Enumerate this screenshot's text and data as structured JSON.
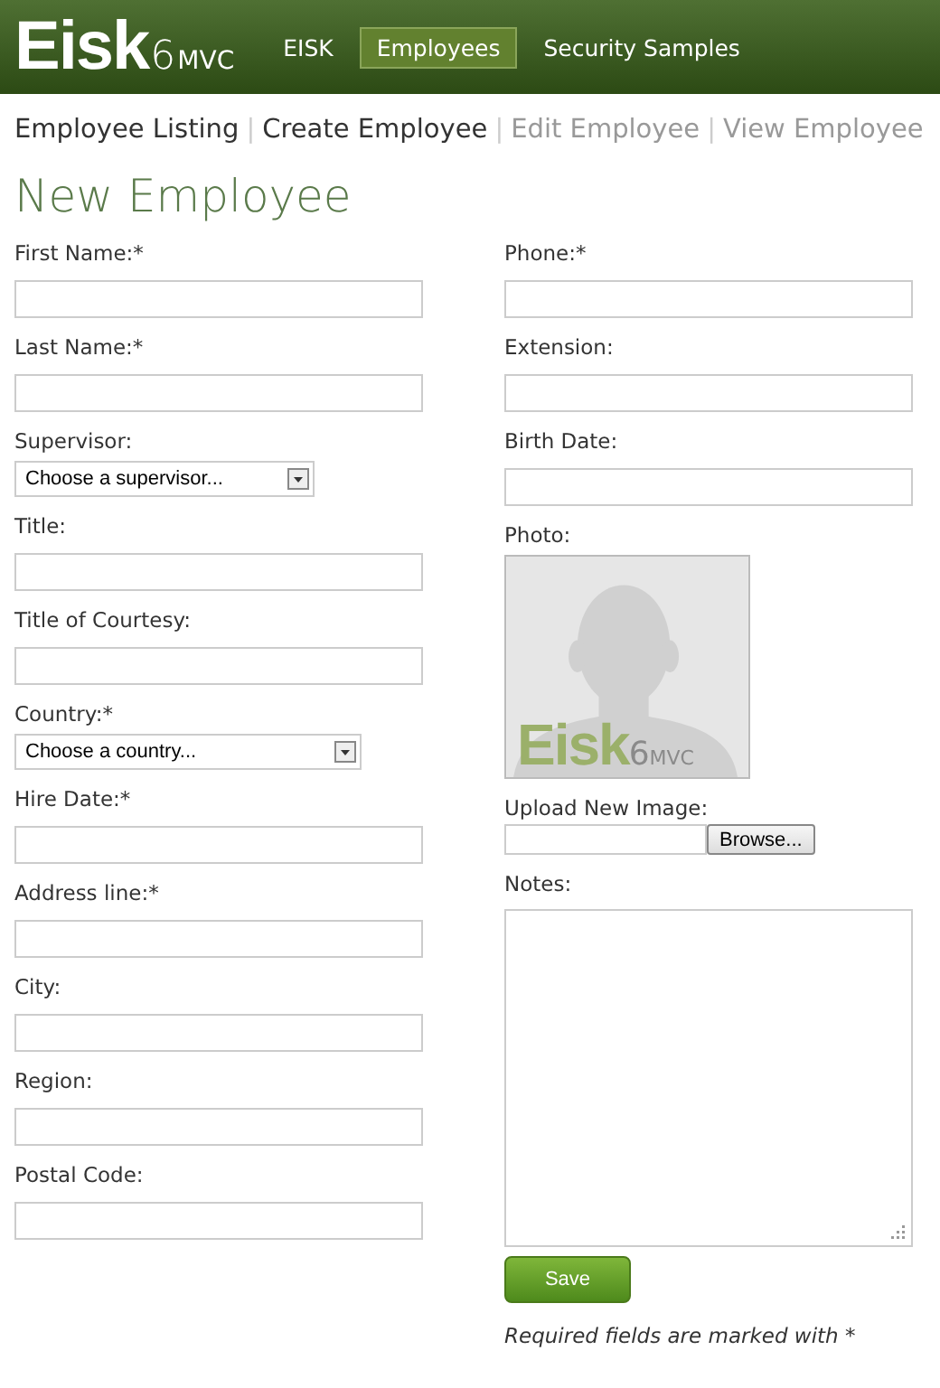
{
  "header": {
    "logo": {
      "main": "Eisk",
      "version": "6",
      "suffix": "MVC"
    },
    "nav": [
      {
        "label": "EISK",
        "selected": false
      },
      {
        "label": "Employees",
        "selected": true
      },
      {
        "label": "Security Samples",
        "selected": false
      }
    ]
  },
  "breadcrumb": {
    "separator": "|",
    "links": [
      {
        "label": "Employee Listing",
        "disabled": false
      },
      {
        "label": "Create Employee",
        "disabled": false
      },
      {
        "label": "Edit Employee",
        "disabled": true
      },
      {
        "label": "View Employee",
        "disabled": true
      }
    ]
  },
  "heading": "New Employee",
  "left_fields": [
    {
      "kind": "text",
      "label": "First Name:*"
    },
    {
      "kind": "text",
      "label": "Last Name:*"
    },
    {
      "kind": "select",
      "label": "Supervisor:",
      "value": "Choose a supervisor..."
    },
    {
      "kind": "text",
      "label": "Title:"
    },
    {
      "kind": "text",
      "label": "Title of Courtesy:"
    },
    {
      "kind": "select",
      "label": "Country:*",
      "value": "Choose a country...",
      "wide": true
    },
    {
      "kind": "text",
      "label": "Hire Date:*"
    },
    {
      "kind": "text",
      "label": "Address line:*"
    },
    {
      "kind": "text",
      "label": "City:"
    },
    {
      "kind": "text",
      "label": "Region:"
    },
    {
      "kind": "text",
      "label": "Postal Code:"
    }
  ],
  "right_fields": [
    {
      "kind": "text",
      "label": "Phone:*"
    },
    {
      "kind": "text",
      "label": "Extension:"
    },
    {
      "kind": "text",
      "label": "Birth Date:"
    },
    {
      "label": "Photo:",
      "logo": {
        "main": "Eisk",
        "version": "6",
        "suffix": "MVC"
      }
    },
    {
      "kind": "file",
      "label": "Upload New Image:",
      "button": "Browse..."
    },
    {
      "kind": "textarea",
      "label": "Notes:"
    }
  ],
  "save_button": "Save",
  "footnote": "Required fields are marked with *"
}
